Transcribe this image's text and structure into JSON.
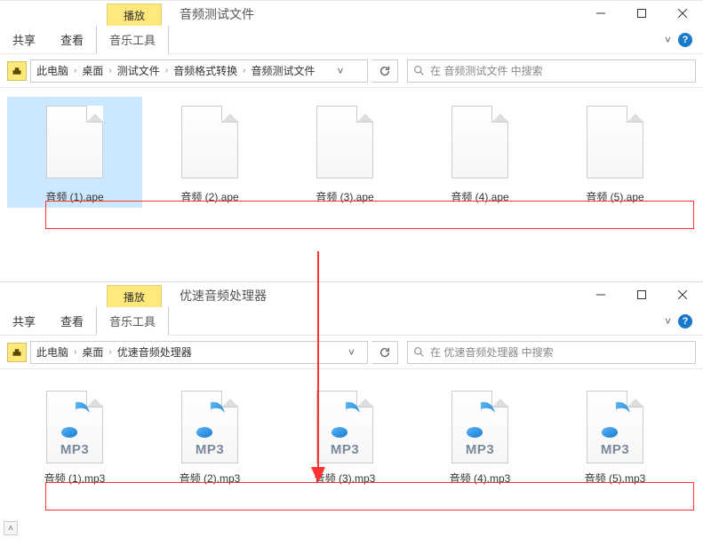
{
  "window1": {
    "play_tab": "播放",
    "title": "音频测试文件",
    "ribbon": {
      "share": "共享",
      "view": "查看",
      "music_tools": "音乐工具"
    },
    "breadcrumbs": [
      "此电脑",
      "桌面",
      "测试文件",
      "音频格式转换",
      "音频测试文件"
    ],
    "search_placeholder": "在 音频测试文件 中搜索",
    "files": [
      "音频 (1).ape",
      "音频 (2).ape",
      "音频 (3).ape",
      "音频 (4).ape",
      "音频 (5).ape"
    ]
  },
  "window2": {
    "play_tab": "播放",
    "title": "优速音频处理器",
    "ribbon": {
      "share": "共享",
      "view": "查看",
      "music_tools": "音乐工具"
    },
    "breadcrumbs": [
      "此电脑",
      "桌面",
      "优速音频处理器"
    ],
    "search_placeholder": "在 优速音频处理器 中搜索",
    "mp3_label": "MP3",
    "files": [
      "音频 (1).mp3",
      "音频 (2).mp3",
      "音频 (3).mp3",
      "音频 (4).mp3",
      "音频 (5).mp3"
    ]
  }
}
